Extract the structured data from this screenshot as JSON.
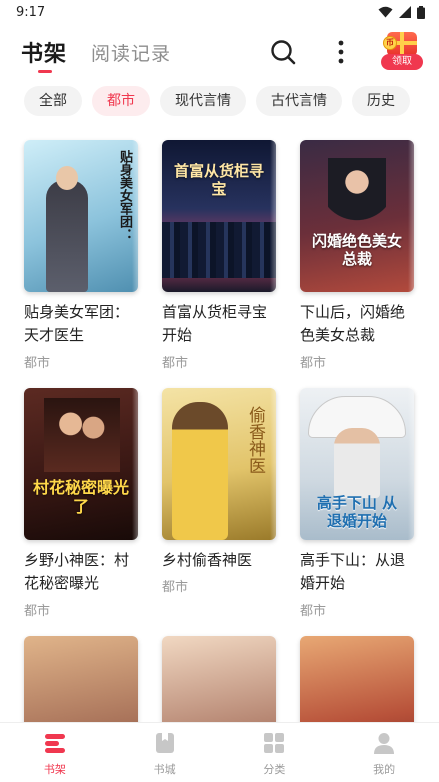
{
  "status_bar": {
    "time": "9:17"
  },
  "header": {
    "tab_shelf": "书架",
    "tab_history": "阅读记录",
    "gift_coin": "币",
    "gift_label": "领取"
  },
  "filters": [
    {
      "label": "全部",
      "active": false
    },
    {
      "label": "都市",
      "active": true
    },
    {
      "label": "现代言情",
      "active": false
    },
    {
      "label": "古代言情",
      "active": false
    },
    {
      "label": "历史",
      "active": false
    }
  ],
  "books": [
    {
      "title": "贴身美女军团：天才医生",
      "category": "都市",
      "cover_text": "贴身美女军团：",
      "cover_colors": [
        "#bfe3f0",
        "#6fa9c7"
      ]
    },
    {
      "title": "首富从货柜寻宝开始",
      "category": "都市",
      "cover_text": "首富从货柜寻宝",
      "cover_colors": [
        "#1d2a4d",
        "#3a4f7e"
      ]
    },
    {
      "title": "下山后，闪婚绝色美女总裁",
      "category": "都市",
      "cover_text": "闪婚绝色美女总裁",
      "cover_colors": [
        "#2a1c33",
        "#8a3030"
      ]
    },
    {
      "title": "乡野小神医：村花秘密曝光",
      "category": "都市",
      "cover_text": "村花秘密曝光了",
      "cover_colors": [
        "#4a1f1a",
        "#2a1010"
      ]
    },
    {
      "title": "乡村偷香神医",
      "category": "都市",
      "cover_text": "偷香神医",
      "cover_colors": [
        "#f1d88a",
        "#c8a24a"
      ]
    },
    {
      "title": "高手下山：从退婚开始",
      "category": "都市",
      "cover_text": "高手下山 从退婚开始",
      "cover_colors": [
        "#dfe6ec",
        "#9fb3c2"
      ]
    },
    {
      "title": "",
      "category": "",
      "cover_text": "",
      "cover_colors": [
        "#c99a7a",
        "#7a4a36"
      ]
    },
    {
      "title": "",
      "category": "",
      "cover_text": "",
      "cover_colors": [
        "#e8c9b0",
        "#8a5a4a"
      ]
    },
    {
      "title": "",
      "category": "",
      "cover_text": "",
      "cover_colors": [
        "#d89a6a",
        "#7a2a2a"
      ]
    }
  ],
  "bottom_nav": [
    {
      "label": "书架",
      "icon": "bookshelf-icon",
      "active": true
    },
    {
      "label": "书城",
      "icon": "book-store-icon",
      "active": false
    },
    {
      "label": "分类",
      "icon": "category-grid-icon",
      "active": false
    },
    {
      "label": "我的",
      "icon": "profile-icon",
      "active": false
    }
  ],
  "colors": {
    "accent": "#f0384f",
    "chip_bg": "#f3f3f3",
    "chip_active_bg": "#fdecee"
  }
}
